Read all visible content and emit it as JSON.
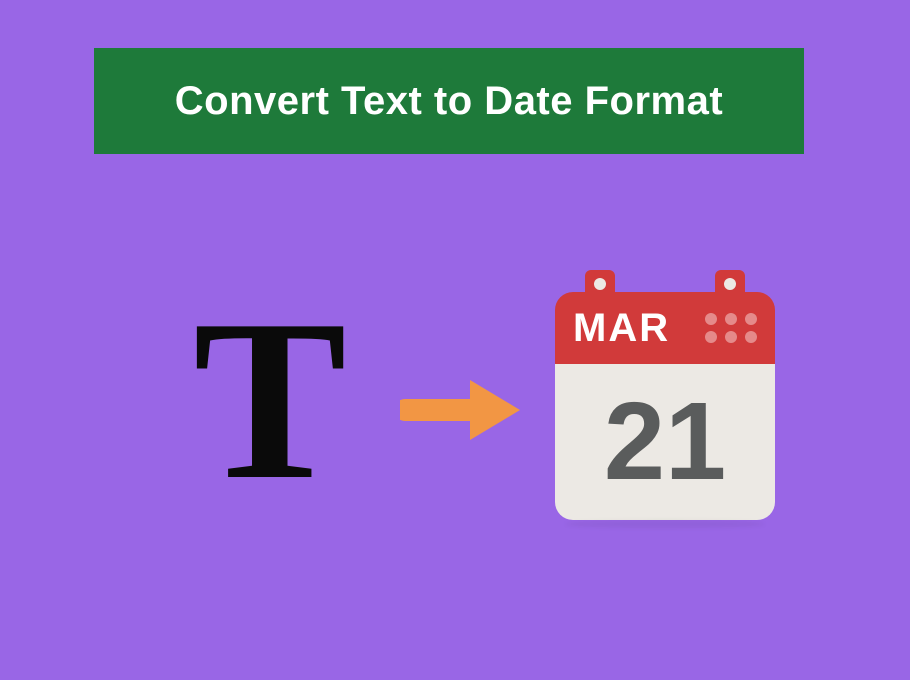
{
  "title": "Convert Text to Date Format",
  "text_glyph": "T",
  "calendar": {
    "month": "MAR",
    "day": "21"
  },
  "colors": {
    "background": "#9966e6",
    "banner": "#1e7a3a",
    "banner_text": "#ffffff",
    "arrow": "#f29644",
    "calendar_header": "#d13a3a",
    "calendar_body": "#ece9e4",
    "calendar_day_text": "#5a5c5c"
  }
}
